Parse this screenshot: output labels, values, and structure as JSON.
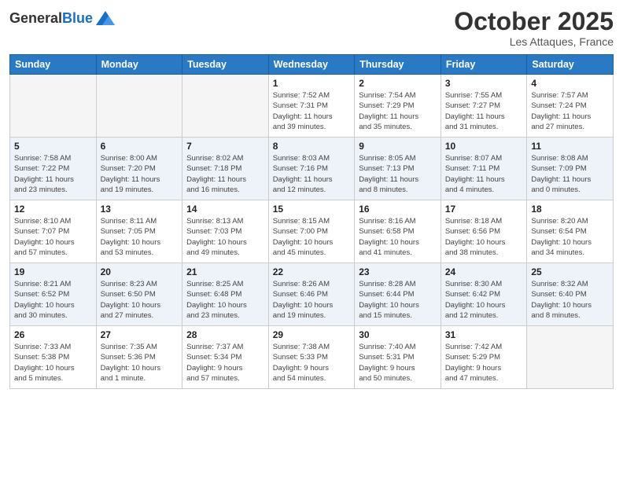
{
  "header": {
    "logo_line1": "General",
    "logo_line2": "Blue",
    "month": "October 2025",
    "location": "Les Attaques, France"
  },
  "weekdays": [
    "Sunday",
    "Monday",
    "Tuesday",
    "Wednesday",
    "Thursday",
    "Friday",
    "Saturday"
  ],
  "weeks": [
    [
      {
        "day": "",
        "info": ""
      },
      {
        "day": "",
        "info": ""
      },
      {
        "day": "",
        "info": ""
      },
      {
        "day": "1",
        "info": "Sunrise: 7:52 AM\nSunset: 7:31 PM\nDaylight: 11 hours\nand 39 minutes."
      },
      {
        "day": "2",
        "info": "Sunrise: 7:54 AM\nSunset: 7:29 PM\nDaylight: 11 hours\nand 35 minutes."
      },
      {
        "day": "3",
        "info": "Sunrise: 7:55 AM\nSunset: 7:27 PM\nDaylight: 11 hours\nand 31 minutes."
      },
      {
        "day": "4",
        "info": "Sunrise: 7:57 AM\nSunset: 7:24 PM\nDaylight: 11 hours\nand 27 minutes."
      }
    ],
    [
      {
        "day": "5",
        "info": "Sunrise: 7:58 AM\nSunset: 7:22 PM\nDaylight: 11 hours\nand 23 minutes."
      },
      {
        "day": "6",
        "info": "Sunrise: 8:00 AM\nSunset: 7:20 PM\nDaylight: 11 hours\nand 19 minutes."
      },
      {
        "day": "7",
        "info": "Sunrise: 8:02 AM\nSunset: 7:18 PM\nDaylight: 11 hours\nand 16 minutes."
      },
      {
        "day": "8",
        "info": "Sunrise: 8:03 AM\nSunset: 7:16 PM\nDaylight: 11 hours\nand 12 minutes."
      },
      {
        "day": "9",
        "info": "Sunrise: 8:05 AM\nSunset: 7:13 PM\nDaylight: 11 hours\nand 8 minutes."
      },
      {
        "day": "10",
        "info": "Sunrise: 8:07 AM\nSunset: 7:11 PM\nDaylight: 11 hours\nand 4 minutes."
      },
      {
        "day": "11",
        "info": "Sunrise: 8:08 AM\nSunset: 7:09 PM\nDaylight: 11 hours\nand 0 minutes."
      }
    ],
    [
      {
        "day": "12",
        "info": "Sunrise: 8:10 AM\nSunset: 7:07 PM\nDaylight: 10 hours\nand 57 minutes."
      },
      {
        "day": "13",
        "info": "Sunrise: 8:11 AM\nSunset: 7:05 PM\nDaylight: 10 hours\nand 53 minutes."
      },
      {
        "day": "14",
        "info": "Sunrise: 8:13 AM\nSunset: 7:03 PM\nDaylight: 10 hours\nand 49 minutes."
      },
      {
        "day": "15",
        "info": "Sunrise: 8:15 AM\nSunset: 7:00 PM\nDaylight: 10 hours\nand 45 minutes."
      },
      {
        "day": "16",
        "info": "Sunrise: 8:16 AM\nSunset: 6:58 PM\nDaylight: 10 hours\nand 41 minutes."
      },
      {
        "day": "17",
        "info": "Sunrise: 8:18 AM\nSunset: 6:56 PM\nDaylight: 10 hours\nand 38 minutes."
      },
      {
        "day": "18",
        "info": "Sunrise: 8:20 AM\nSunset: 6:54 PM\nDaylight: 10 hours\nand 34 minutes."
      }
    ],
    [
      {
        "day": "19",
        "info": "Sunrise: 8:21 AM\nSunset: 6:52 PM\nDaylight: 10 hours\nand 30 minutes."
      },
      {
        "day": "20",
        "info": "Sunrise: 8:23 AM\nSunset: 6:50 PM\nDaylight: 10 hours\nand 27 minutes."
      },
      {
        "day": "21",
        "info": "Sunrise: 8:25 AM\nSunset: 6:48 PM\nDaylight: 10 hours\nand 23 minutes."
      },
      {
        "day": "22",
        "info": "Sunrise: 8:26 AM\nSunset: 6:46 PM\nDaylight: 10 hours\nand 19 minutes."
      },
      {
        "day": "23",
        "info": "Sunrise: 8:28 AM\nSunset: 6:44 PM\nDaylight: 10 hours\nand 15 minutes."
      },
      {
        "day": "24",
        "info": "Sunrise: 8:30 AM\nSunset: 6:42 PM\nDaylight: 10 hours\nand 12 minutes."
      },
      {
        "day": "25",
        "info": "Sunrise: 8:32 AM\nSunset: 6:40 PM\nDaylight: 10 hours\nand 8 minutes."
      }
    ],
    [
      {
        "day": "26",
        "info": "Sunrise: 7:33 AM\nSunset: 5:38 PM\nDaylight: 10 hours\nand 5 minutes."
      },
      {
        "day": "27",
        "info": "Sunrise: 7:35 AM\nSunset: 5:36 PM\nDaylight: 10 hours\nand 1 minute."
      },
      {
        "day": "28",
        "info": "Sunrise: 7:37 AM\nSunset: 5:34 PM\nDaylight: 9 hours\nand 57 minutes."
      },
      {
        "day": "29",
        "info": "Sunrise: 7:38 AM\nSunset: 5:33 PM\nDaylight: 9 hours\nand 54 minutes."
      },
      {
        "day": "30",
        "info": "Sunrise: 7:40 AM\nSunset: 5:31 PM\nDaylight: 9 hours\nand 50 minutes."
      },
      {
        "day": "31",
        "info": "Sunrise: 7:42 AM\nSunset: 5:29 PM\nDaylight: 9 hours\nand 47 minutes."
      },
      {
        "day": "",
        "info": ""
      }
    ]
  ]
}
